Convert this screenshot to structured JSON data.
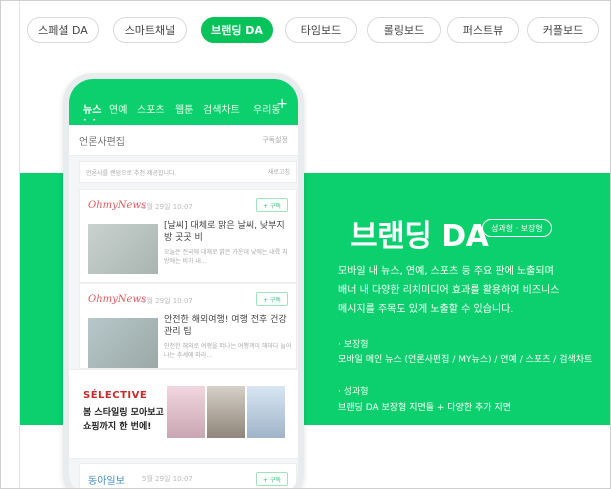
{
  "tabs": [
    {
      "label": "스페셜 DA",
      "active": false
    },
    {
      "label": "스마트채널",
      "active": false
    },
    {
      "label": "브랜딩 DA",
      "active": true
    },
    {
      "label": "타임보드",
      "active": false
    },
    {
      "label": "롤링보드",
      "active": false
    },
    {
      "label": "퍼스트뷰",
      "active": false
    },
    {
      "label": "커플보드",
      "active": false
    }
  ],
  "brand": {
    "title": "브랜딩 DA",
    "badge": "성과형 · 보장형",
    "desc": [
      "모바일 내 뉴스, 연예, 스포츠 등 주요 판에 노출되며",
      "배너 내 다양한 리치미디어 효과를 활용하여 비즈니스",
      "메시지를 주목도 있게 노출할 수 있습니다."
    ],
    "guaranteed_label": "· 보장형",
    "guaranteed_text": "모바일 메인 뉴스 (언론사편집 / MY뉴스) / 연예 / 스포츠 / 검색차트",
    "performance_label": "· 성과형",
    "performance_text": "브랜딩 DA 보장형 지면들 + 다양한 추가 지면"
  },
  "phone": {
    "nav": [
      "뉴스",
      "연예",
      "스포츠",
      "웹툰",
      "검색차트",
      "우리동"
    ],
    "plus": "+",
    "press_title": "언론사편집",
    "press_setting": "구독설정",
    "notice": "언론사를 랜덤으로 추천 제공합니다.",
    "notice_right": "새로고침",
    "cards": [
      {
        "logo": "OhmyNews",
        "date": "5월 29일 10:07",
        "subscribe": "+ 구독",
        "headline": "[날씨] 대체로 맑은 날씨, 낮부지 방 곳곳 비",
        "body": "오늘은 전국에 대체로 맑은 가운데 낮에는 내륙 지방에는 비가 내..."
      },
      {
        "logo": "OhmyNews",
        "date": "5월 29일 10:07",
        "subscribe": "+ 구독",
        "headline": "안전한 해외여행! 여행 전후 건강 관리 팁",
        "body": "안전한 해외로 여행을 떠나는 여행객이 해마다 늘어나는 추세에 따라..."
      }
    ],
    "ad_brand": "SÉLECTIVE",
    "ad_copy": [
      "봄 스타일링 모아보고",
      "쇼핑까지 한 번에!"
    ],
    "card3_logo": "동아일보",
    "card3_date": "5월 29일 10:07",
    "card3_subscribe": "+ 구독"
  }
}
